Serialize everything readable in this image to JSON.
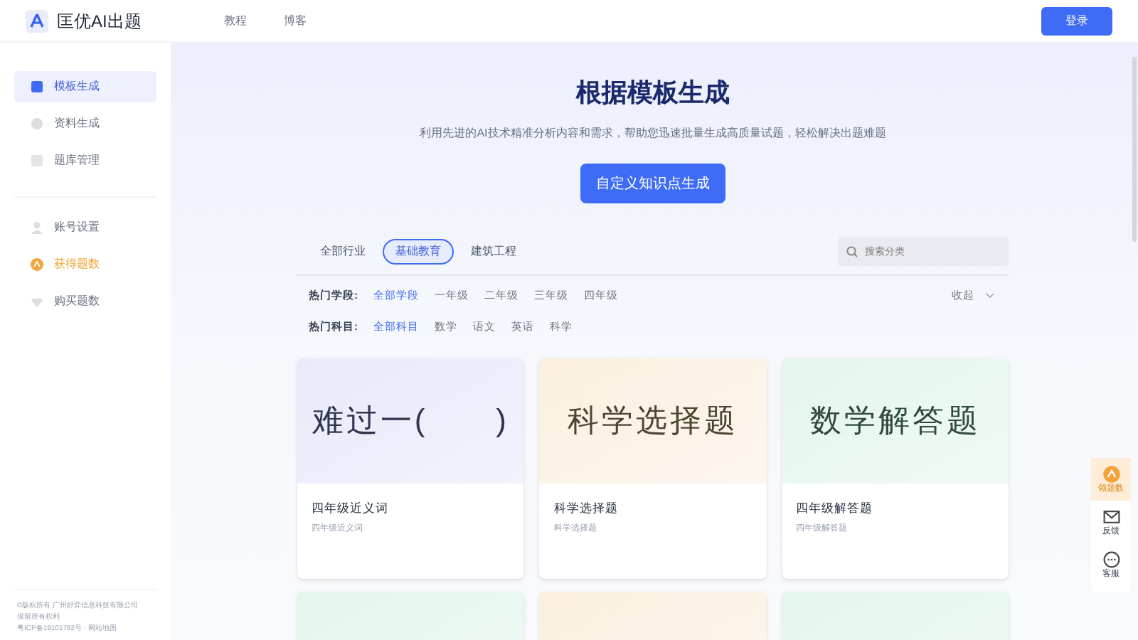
{
  "header": {
    "logo_text": "匡优AI出题",
    "nav": [
      {
        "label": "教程"
      },
      {
        "label": "博客"
      }
    ],
    "login_button": "登录"
  },
  "sidebar": {
    "groups": [
      [
        {
          "label": "模板生成",
          "selected": true,
          "highlight": false
        },
        {
          "label": "资料生成",
          "selected": false,
          "highlight": false
        },
        {
          "label": "题库管理",
          "selected": false,
          "highlight": false
        }
      ],
      [
        {
          "label": "账号设置",
          "selected": false,
          "highlight": false
        },
        {
          "label": "获得题数",
          "selected": false,
          "highlight": true
        },
        {
          "label": "购买题数",
          "selected": false,
          "highlight": false
        }
      ]
    ],
    "footer": [
      "©版权所有 广州好弈信息科技有限公司",
      "保留所有权利",
      "粤ICP备19101762号 · 网站地图"
    ]
  },
  "hero": {
    "title": "根据模板生成",
    "subtitle": "利用先进的AI技术精准分析内容和需求，帮助您迅速批量生成高质量试题，轻松解决出题难题",
    "button": "自定义知识点生成"
  },
  "industries": [
    {
      "label": "全部行业",
      "selected": false
    },
    {
      "label": "基础教育",
      "selected": true
    },
    {
      "label": "建筑工程",
      "selected": false
    }
  ],
  "search": {
    "placeholder": "搜索分类"
  },
  "filters": [
    {
      "label": "热门学段:",
      "options": [
        {
          "label": "全部学段",
          "selected": true
        },
        {
          "label": "一年级",
          "selected": false
        },
        {
          "label": "二年级",
          "selected": false
        },
        {
          "label": "三年级",
          "selected": false
        },
        {
          "label": "四年级",
          "selected": false
        }
      ]
    },
    {
      "label": "热门科目:",
      "options": [
        {
          "label": "全部科目",
          "selected": true
        },
        {
          "label": "数学",
          "selected": false
        },
        {
          "label": "语文",
          "selected": false
        },
        {
          "label": "英语",
          "selected": false
        },
        {
          "label": "科学",
          "selected": false
        }
      ]
    }
  ],
  "collapse": "收起",
  "cards": [
    {
      "cover": "难过一(　　)",
      "title": "四年级近义词",
      "desc": "四年级近义词"
    },
    {
      "cover": "科学选择题",
      "title": "科学选择题",
      "desc": "科学选择题"
    },
    {
      "cover": "数学解答题",
      "title": "四年级解答题",
      "desc": "四年级解答题"
    }
  ],
  "float_bar": [
    {
      "label": "领题数",
      "highlight": true
    },
    {
      "label": "反馈",
      "highlight": false
    },
    {
      "label": "客服",
      "highlight": false
    }
  ]
}
